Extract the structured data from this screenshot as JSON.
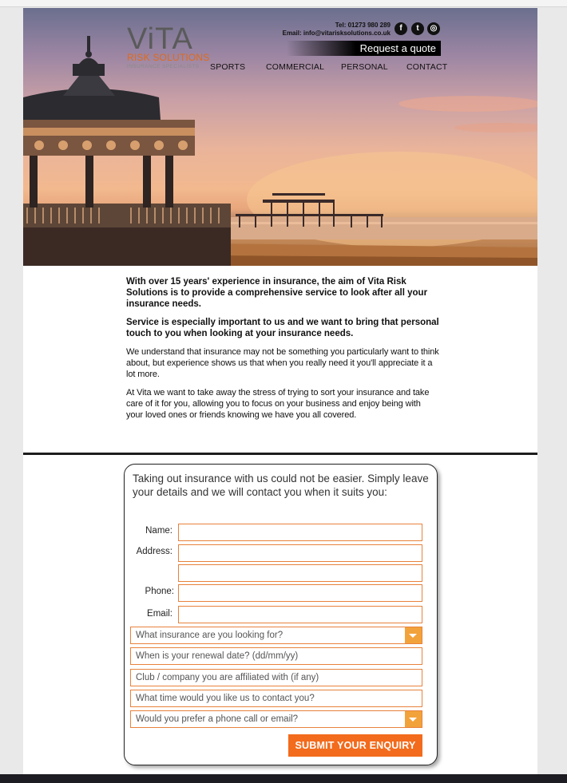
{
  "header": {
    "logo": {
      "name": "ViTA",
      "subtitle": "RISK SOLUTIONS",
      "tagline": "INSURANCE SPECIALISTS"
    },
    "contact": {
      "tel": "Tel: 01273 980 289",
      "email": "Email: info@vitarisksolutions.co.uk"
    },
    "social": [
      {
        "icon": "facebook-icon",
        "glyph": "f"
      },
      {
        "icon": "twitter-icon",
        "glyph": "t"
      },
      {
        "icon": "instagram-icon",
        "glyph": "◎"
      }
    ],
    "quote_button": "Request a quote",
    "nav": [
      "SPORTS",
      "COMMERCIAL",
      "PERSONAL",
      "CONTACT"
    ]
  },
  "intro": {
    "lead_1": "With over 15 years' experience in insurance, the aim of Vita Risk Solutions is to provide a comprehensive service to look after all your insurance needs.",
    "lead_2": "Service is especially important to us and we want to bring that personal touch to you when looking at your insurance needs.",
    "body_1": "We understand that insurance may not be something you particularly want to think about, but experience shows us that when you really need it you'll appreciate it a lot more.",
    "body_2": "At Vita we want to take away the stress of trying to sort your insurance and take care of it for you, allowing you to focus on your business and enjoy being with your loved ones or friends knowing we have you all covered."
  },
  "form": {
    "intro": "Taking out insurance with us could not be easier. Simply leave your details and we will contact you when it suits you:",
    "labels": {
      "name": "Name:",
      "address": "Address:",
      "phone": "Phone:",
      "email": "Email:"
    },
    "values": {
      "name": "",
      "address_1": "",
      "address_2": "",
      "phone": "",
      "email": ""
    },
    "insurance_select": "What insurance are you looking for?",
    "renewal_placeholder": "When is your renewal date? (dd/mm/yy)",
    "club_placeholder": "Club / company you are affiliated with (if any)",
    "time_placeholder": "What time would you like us to contact you?",
    "contact_select": "Would you prefer a phone call or email?",
    "submit": "SUBMIT YOUR ENQUIRY"
  },
  "colors": {
    "accent": "#f36b1c",
    "field_border": "#e8823c",
    "select_arrow": "#f2a23a"
  }
}
